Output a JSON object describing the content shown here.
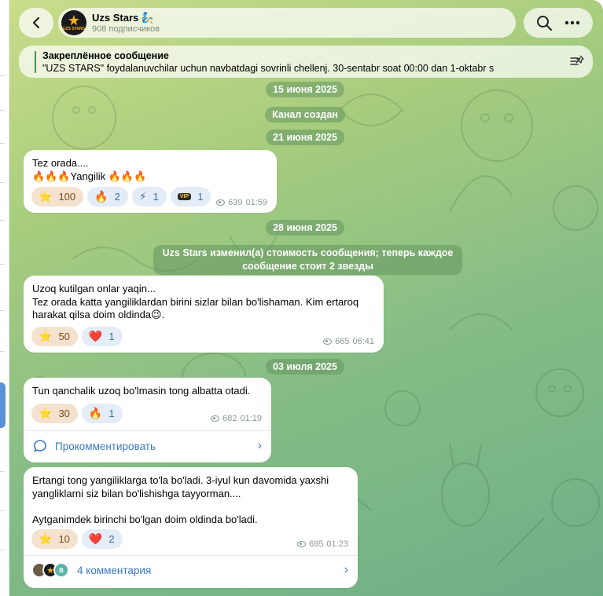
{
  "header": {
    "channel_title": "Uzs Stars 🧞",
    "subscribers": "908 подписчиков",
    "avatar_text": "UZS STARS"
  },
  "pinned": {
    "title": "Закреплённое сообщение",
    "text": "\"UZS STARS\" foydalanuvchilar uchun navbatdagi sovrinli chellenj.  30-sentabr soat 00:00 dan  1-oktabr s"
  },
  "dates": {
    "d1": "15 июня 2025",
    "created": "Канал создан",
    "d2": "21 июня 2025",
    "d3": "28 июня 2025",
    "d4": "03 июля 2025"
  },
  "service_msg": "Uzs Stars изменил(а) стоимость сообщения; теперь каждое сообщение стоит 2 звезды",
  "messages": [
    {
      "text": "Tez orada....\n🔥🔥🔥Yangilik 🔥🔥🔥",
      "reactions": [
        {
          "emoji": "⭐",
          "count": "100"
        },
        {
          "emoji": "🔥",
          "count": "2"
        },
        {
          "emoji": "⚡",
          "count": "1"
        },
        {
          "emoji": "VIP",
          "count": "1"
        }
      ],
      "views": "639",
      "time": "01:59"
    },
    {
      "text": "Uzoq kutilgan onlar yaqin...\nTez orada katta yangiliklardan birini sizlar bilan bo'lishaman. Kim ertaroq\nharakat qilsa doim oldinda😉.",
      "reactions": [
        {
          "emoji": "⭐",
          "count": "50"
        },
        {
          "emoji": "❤️",
          "count": "1"
        }
      ],
      "views": "665",
      "time": "06:41"
    },
    {
      "text": "Tun qanchalik uzoq bo'lmasin tong albatta otadi.",
      "reactions": [
        {
          "emoji": "⭐",
          "count": "30"
        },
        {
          "emoji": "🔥",
          "count": "1"
        }
      ],
      "views": "682",
      "time": "01:19",
      "comment_label": "Прокомментировать"
    },
    {
      "text": "Ertangi tong yangiliklarga to'la bo'ladi. 3-iyul  kun davomida yaxshi\nyangliklarni siz bilan bo'lishishga tayyorman....\n\nAytganimdek birinchi bo'lgan doim oldinda bo'ladi.",
      "reactions": [
        {
          "emoji": "⭐",
          "count": "10"
        },
        {
          "emoji": "❤️",
          "count": "2"
        }
      ],
      "views": "695",
      "time": "01:23",
      "comment_label": "4 комментария",
      "commenter_initial": "B"
    }
  ]
}
